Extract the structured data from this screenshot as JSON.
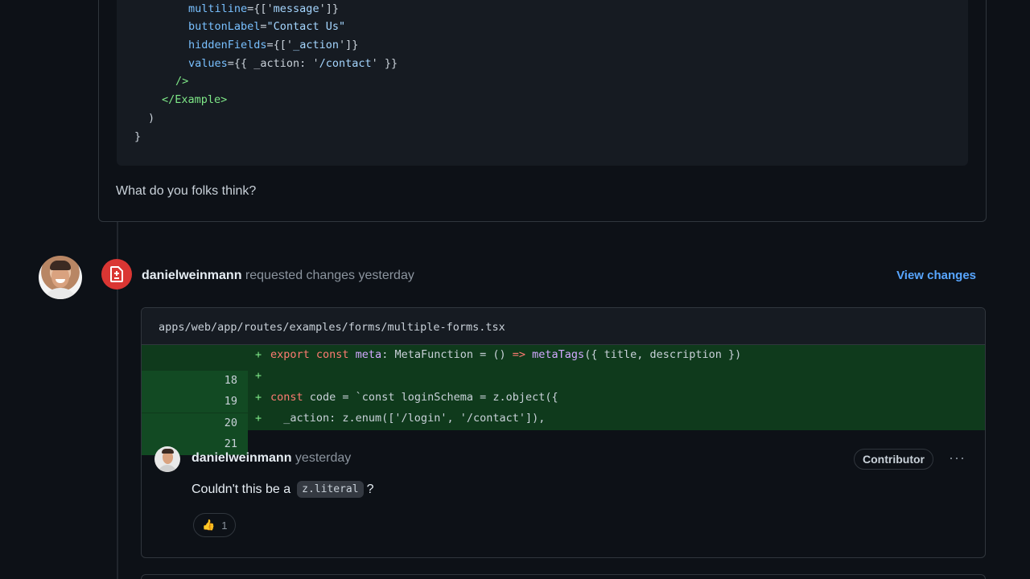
{
  "code_block": {
    "lines": [
      [
        {
          "t": "multiline",
          "c": "attr"
        },
        {
          "t": "={['",
          "c": "plain"
        },
        {
          "t": "message",
          "c": "str"
        },
        {
          "t": "']}",
          "c": "plain"
        }
      ],
      [
        {
          "t": "buttonLabel",
          "c": "attr"
        },
        {
          "t": "=",
          "c": "plain"
        },
        {
          "t": "\"Contact Us\"",
          "c": "str"
        }
      ],
      [
        {
          "t": "hiddenFields",
          "c": "attr"
        },
        {
          "t": "={['",
          "c": "plain"
        },
        {
          "t": "_action",
          "c": "str"
        },
        {
          "t": "']}",
          "c": "plain"
        }
      ],
      [
        {
          "t": "values",
          "c": "attr"
        },
        {
          "t": "={{ _action: '",
          "c": "plain"
        },
        {
          "t": "/contact",
          "c": "str"
        },
        {
          "t": "' }}",
          "c": "plain"
        }
      ],
      [
        {
          "t": "/>",
          "c": "tag"
        }
      ],
      [
        {
          "t": "</",
          "c": "tag"
        },
        {
          "t": "Example",
          "c": "tag"
        },
        {
          "t": ">",
          "c": "tag"
        }
      ],
      [
        {
          "t": ")",
          "c": "plain"
        }
      ],
      [
        {
          "t": "}",
          "c": "plain"
        }
      ]
    ]
  },
  "comment": {
    "text": "What do you folks think?"
  },
  "review": {
    "author": "danielweinmann",
    "action": "requested changes yesterday",
    "view_changes": "View changes",
    "icon": "file-diff-icon",
    "badge_color": "#da3633"
  },
  "diff": {
    "path": "apps/web/app/routes/examples/forms/multiple-forms.tsx",
    "lines": [
      {
        "num": "18",
        "sign": "+",
        "tokens": [
          {
            "t": "export const ",
            "c": "k"
          },
          {
            "t": "meta",
            "c": "fn"
          },
          {
            "t": ": MetaFunction = () ",
            "c": "plain"
          },
          {
            "t": "=>",
            "c": "k"
          },
          {
            "t": " ",
            "c": "plain"
          },
          {
            "t": "metaTags",
            "c": "fn"
          },
          {
            "t": "({ title, description })",
            "c": "plain"
          }
        ]
      },
      {
        "num": "19",
        "sign": "+",
        "tokens": []
      },
      {
        "num": "20",
        "sign": "+",
        "tokens": [
          {
            "t": "const ",
            "c": "k"
          },
          {
            "t": "code = `const loginSchema = z.object({",
            "c": "plain"
          }
        ]
      },
      {
        "num": "21",
        "sign": "+",
        "tokens": [
          {
            "t": "  _action: z.enum(['/login', '/contact']),",
            "c": "plain"
          }
        ]
      }
    ]
  },
  "review_comment": {
    "author": "danielweinmann",
    "time": "yesterday",
    "badge": "Contributor",
    "more": "···",
    "text_before": "Couldn't this be a",
    "inline_code": "z.literal",
    "text_after": "?",
    "reaction_emoji": "👍",
    "reaction_count": "1"
  },
  "colors": {
    "link": "#58a6ff",
    "added_bg": "#0f3a1c",
    "danger": "#da3633"
  }
}
